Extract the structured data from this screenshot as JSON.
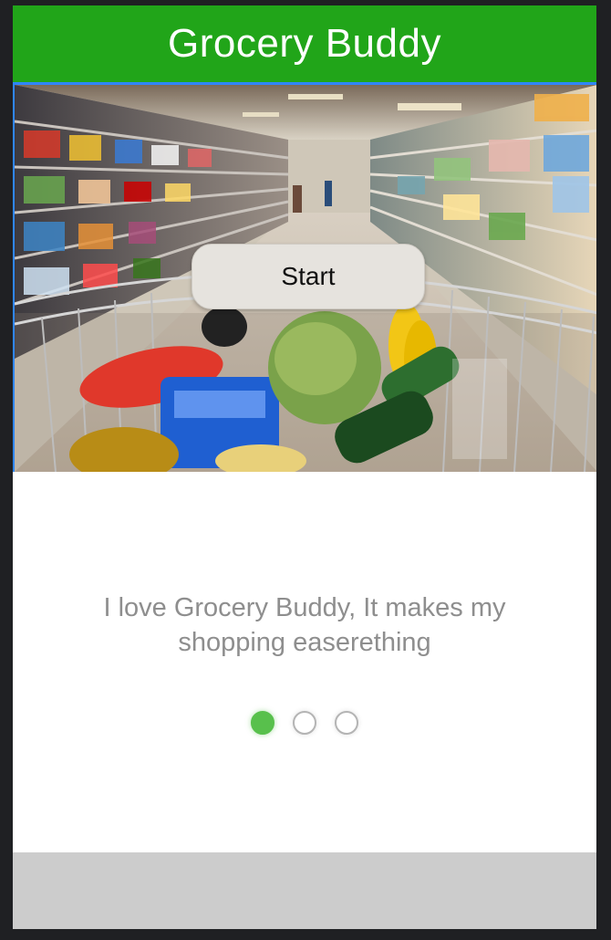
{
  "app": {
    "title": "Grocery Buddy"
  },
  "hero": {
    "image_subject": "supermarket aisle with a shopping cart full of groceries",
    "start_label": "Start"
  },
  "onboarding": {
    "testimonial": "I love Grocery Buddy, It makes my shopping easerething",
    "pager": {
      "total": 3,
      "active_index": 0
    }
  },
  "colors": {
    "header_bg": "#21a519",
    "accent_border": "#2f86ff",
    "active_dot": "#58c04c",
    "footer_bg": "#cccccc"
  }
}
